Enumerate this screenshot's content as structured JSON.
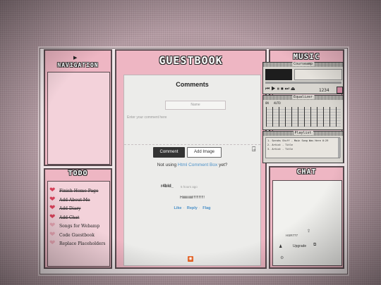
{
  "navigation": {
    "title": "Navigation"
  },
  "guestbook": {
    "title": "Guestbook",
    "heading": "Comments",
    "name_placeholder": "Name",
    "comment_placeholder": "Enter your comment here",
    "comment_button": "Comment",
    "add_image_button": "Add Image",
    "notusing_prefix": "Not using",
    "notusing_link": "Html Comment Box",
    "notusing_suffix": "yet?",
    "comment": {
      "author": "r4bld_",
      "time": "5 hours ago",
      "text": "Hiiiiiiiiiiiii!!!!!!!!!!!!",
      "like": "Like",
      "reply": "Reply",
      "flag": "Flag"
    }
  },
  "todo": {
    "title": "ToDo",
    "items": [
      {
        "label": "Finish Home Page",
        "done": true
      },
      {
        "label": "Add About Me",
        "done": true
      },
      {
        "label": "Add Diary",
        "done": true
      },
      {
        "label": "Add Chat",
        "done": true
      },
      {
        "label": "Songs for Webamp",
        "done": false
      },
      {
        "label": "Code Guestbook",
        "done": false
      },
      {
        "label": "Replace Placeholders",
        "done": false
      }
    ]
  },
  "music": {
    "title": "Music",
    "player_title": "Courseamp",
    "time": "1234",
    "equalizer_title": "Equalizer",
    "eq_on": "ON",
    "eq_auto": "AUTO",
    "playlist_title": "Playlist",
    "playlist": [
      "1. Sarahs Stuff - Main Song Was Here 0:29",
      "2. Artist - Title",
      "3. Artist - Title"
    ]
  },
  "chat": {
    "title": "Chat",
    "user": "HSR777",
    "label": "Upgrade"
  },
  "colors": {
    "panel": "#eeb6c3",
    "panel_inner": "#f3d2da",
    "link": "#4a90c8",
    "button_dark": "#333333"
  }
}
